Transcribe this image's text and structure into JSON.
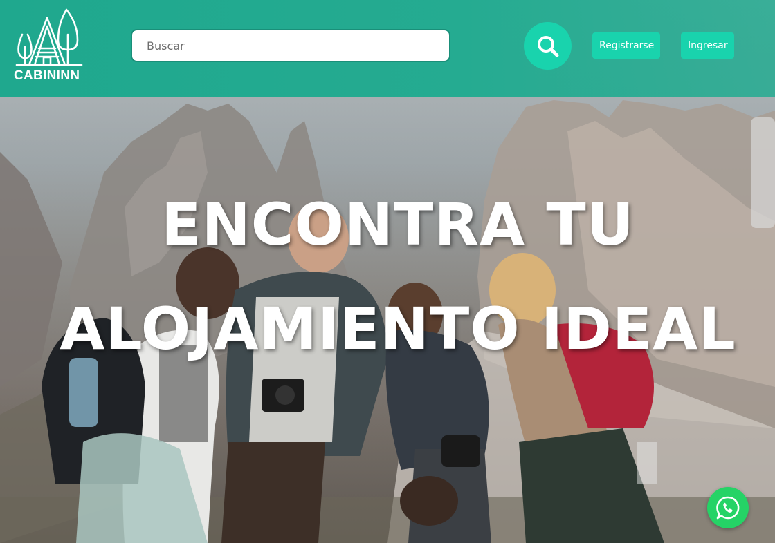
{
  "brand": {
    "name": "CABININN",
    "primary_color": "#25ab91",
    "accent_color": "#19d3ad"
  },
  "header": {
    "search": {
      "placeholder": "Buscar",
      "icon": "search-icon"
    },
    "register_label": "Registrarse",
    "login_label": "Ingresar"
  },
  "hero": {
    "title_line1": "ENCONTRA TU",
    "title_line2": "ALOJAMIENTO IDEAL"
  },
  "floating": {
    "whatsapp_icon": "whatsapp-icon",
    "whatsapp_color": "#25d366"
  }
}
